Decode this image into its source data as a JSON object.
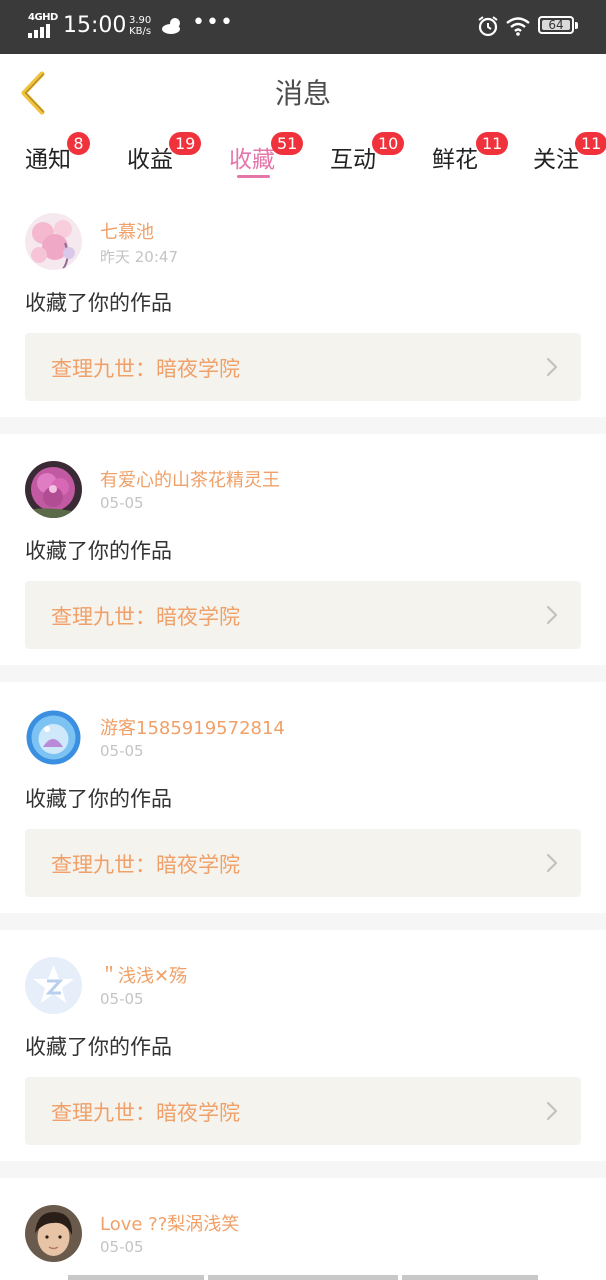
{
  "status_bar": {
    "network": "4GHD",
    "time": "15:00",
    "speed_value": "3.90",
    "speed_unit": "KB/s",
    "dots": "•••",
    "battery": "64"
  },
  "header": {
    "title": "消息"
  },
  "tabs": [
    {
      "label": "通知",
      "badge": "8"
    },
    {
      "label": "收益",
      "badge": "19"
    },
    {
      "label": "收藏",
      "badge": "51"
    },
    {
      "label": "互动",
      "badge": "10"
    },
    {
      "label": "鲜花",
      "badge": "11"
    },
    {
      "label": "关注",
      "badge": "11"
    }
  ],
  "active_tab": "收藏",
  "colors": {
    "accent": "#e576aa",
    "name_orange": "#f0a068",
    "badge_red": "#f0323c"
  },
  "messages": [
    {
      "user": "七慕池",
      "time": "昨天 20:47",
      "action": "收藏了你的作品",
      "work": "查理九世：暗夜学院",
      "avatar": "cherry-blossom-avatar"
    },
    {
      "user": "有爱心的山茶花精灵王",
      "time": "05-05",
      "action": "收藏了你的作品",
      "work": "查理九世：暗夜学院",
      "avatar": "purple-flower-avatar"
    },
    {
      "user": "游客1585919572814",
      "time": "05-05",
      "action": "收藏了你的作品",
      "work": "查理九世：暗夜学院",
      "avatar": "blue-orb-avatar"
    },
    {
      "user": "＂浅浅✕殇",
      "time": "05-05",
      "action": "收藏了你的作品",
      "work": "查理九世：暗夜学院",
      "avatar": "default-star-avatar"
    },
    {
      "user": "Love ??梨涡浅笑",
      "time": "05-05",
      "action": "",
      "work": "",
      "avatar": "boy-portrait-avatar"
    }
  ]
}
